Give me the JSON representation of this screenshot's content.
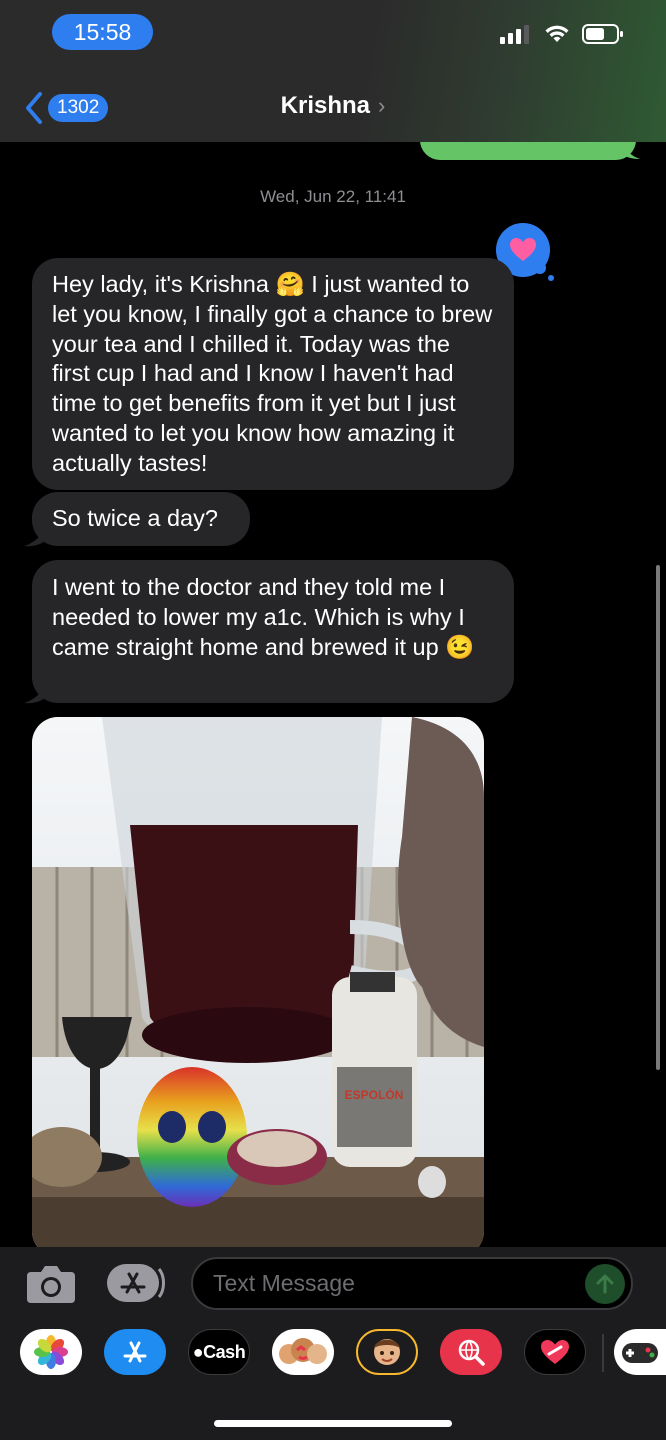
{
  "status_bar": {
    "time": "15:58"
  },
  "header": {
    "back_count": "1302",
    "contact_name": "Krishna",
    "contact_chevron": "›"
  },
  "conversation": {
    "timestamp": "Wed, Jun 22, 11:41",
    "tapback": "heart-icon",
    "messages": [
      {
        "text": "Hey lady, it's Krishna 🤗 I just wanted to let you know, I finally got a chance to brew your tea and I chilled it. Today was the first cup I had and I know I haven't had time to get benefits from it yet but I just wanted to let you know how amazing it actually tastes!"
      },
      {
        "text": "So twice a day?"
      },
      {
        "text": "I went to the doctor and they told me I needed to lower my a1c. Which is why I came straight home and brewed it up 😉"
      }
    ],
    "photo_label": "ESPOLÒN"
  },
  "composer": {
    "placeholder": "Text Message"
  },
  "app_drawer": {
    "apps": [
      "photos-icon",
      "app-store-icon",
      "apple-cash-icon",
      "memoji-stickers-icon",
      "memoji-icon",
      "images-search-icon",
      "digital-touch-icon",
      "game-pigeon-icon"
    ],
    "cash_label": "Cash"
  },
  "colors": {
    "accent": "#2f7ef0",
    "bubble_received": "#262629",
    "bubble_sent": "#65c466"
  }
}
